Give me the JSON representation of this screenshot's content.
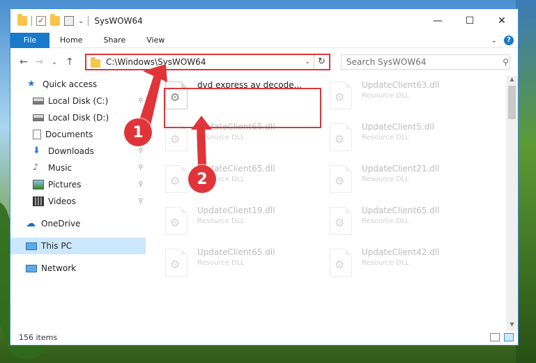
{
  "window": {
    "title": "SysWOW64"
  },
  "titlebar": {
    "minimize_glyph": "—",
    "maximize_glyph": "☐",
    "close_glyph": "✕",
    "check_glyph": "✓"
  },
  "ribbon": {
    "tabs": [
      "File",
      "Home",
      "Share",
      "View"
    ],
    "expand_glyph": "⌄",
    "help_glyph": "?"
  },
  "nav": {
    "back_glyph": "←",
    "forward_glyph": "→",
    "recent_glyph": "⌄",
    "up_glyph": "↑",
    "address": "C:\\Windows\\SysWOW64",
    "address_dropdown_glyph": "⌄",
    "refresh_glyph": "↻",
    "search_placeholder": "Search SysWOW64",
    "search_glyph": "⚲"
  },
  "sidebar": {
    "items": [
      {
        "label": "Quick access",
        "icon": "star-icon",
        "pinned": false
      },
      {
        "label": "Local Disk (C:)",
        "icon": "disk-icon",
        "pinned": true
      },
      {
        "label": "Local Disk (D:)",
        "icon": "disk-icon",
        "pinned": false
      },
      {
        "label": "Documents",
        "icon": "documents-icon",
        "pinned": false
      },
      {
        "label": "Downloads",
        "icon": "downloads-icon",
        "pinned": true
      },
      {
        "label": "Music",
        "icon": "music-icon",
        "pinned": true
      },
      {
        "label": "Pictures",
        "icon": "pictures-icon",
        "pinned": true
      },
      {
        "label": "Videos",
        "icon": "videos-icon",
        "pinned": true
      },
      {
        "label": "OneDrive",
        "icon": "onedrive-icon",
        "pinned": false
      },
      {
        "label": "This PC",
        "icon": "this-pc-icon",
        "pinned": false,
        "selected": true
      },
      {
        "label": "Network",
        "icon": "network-icon",
        "pinned": false
      }
    ],
    "pin_glyph": "📌"
  },
  "files": [
    {
      "name": "dvd express av decode...",
      "type": "",
      "highlighted": true
    },
    {
      "name": "UpdateClient63.dll",
      "type": "Resource DLL"
    },
    {
      "name": "UpdateClient65.dll",
      "type": "Resource DLL"
    },
    {
      "name": "UpdateClient5.dll",
      "type": "Resource DLL"
    },
    {
      "name": "UpdateClient65.dll",
      "type": "Resource DLL"
    },
    {
      "name": "UpdateClient21.dll",
      "type": "Resource DLL"
    },
    {
      "name": "UpdateClient19.dll",
      "type": "Resource DLL"
    },
    {
      "name": "UpdateClient65.dll",
      "type": "Resource DLL"
    },
    {
      "name": "UpdateClient65.dll",
      "type": "Resource DLL"
    },
    {
      "name": "UpdateClient42.dll",
      "type": "Resource DLL"
    }
  ],
  "file_icon_glyph": "⚙",
  "status": {
    "item_count": "156 items"
  },
  "callouts": [
    "1",
    "2"
  ],
  "scroll": {
    "up_glyph": "▲",
    "down_glyph": "▼"
  },
  "colors": {
    "accent": "#1979ca",
    "highlight": "#e0343a",
    "selection": "#cce8ff"
  }
}
